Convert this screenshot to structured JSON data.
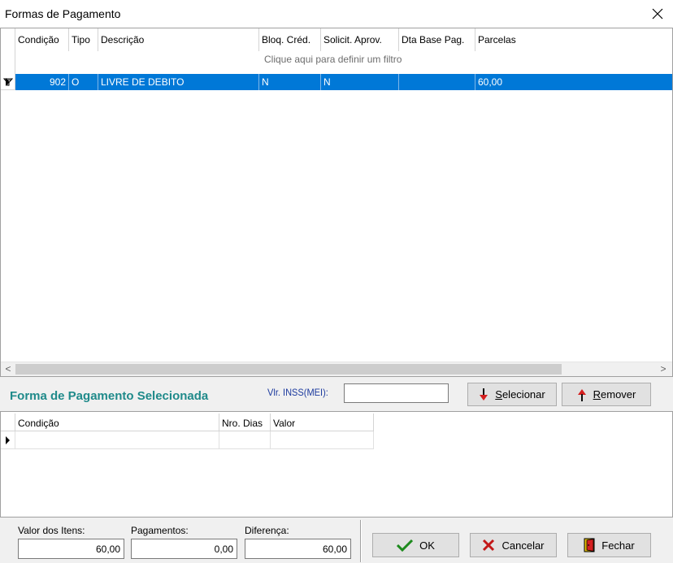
{
  "window": {
    "title": "Formas de Pagamento",
    "close_label": "✕"
  },
  "grid": {
    "columns": [
      "Condição",
      "Tipo",
      "Descrição",
      "Bloq. Créd.",
      "Solicit. Aprov.",
      "Dta Base Pag.",
      "Parcelas"
    ],
    "filter_hint": "Clique aqui para definir um filtro",
    "rows": [
      {
        "condicao": "902",
        "tipo": "O",
        "descricao": "LIVRE DE DEBITO",
        "bloq": "N",
        "solicit": "N",
        "dta_base": "",
        "parcelas": "60,00"
      }
    ],
    "scroll_left": "<",
    "scroll_right": ">"
  },
  "selected_section": {
    "heading": "Forma de Pagamento Selecionada",
    "inss_label": "Vlr. INSS(MEI):",
    "inss_value": "",
    "select_button": {
      "mnemonic": "S",
      "rest": "elecionar"
    },
    "remove_button": {
      "mnemonic": "R",
      "rest": "emover"
    }
  },
  "grid2": {
    "columns": [
      "Condição",
      "Nro. Dias",
      "Valor"
    ]
  },
  "totals": {
    "valor_itens_label": "Valor dos Itens:",
    "valor_itens": "60,00",
    "pagamentos_label": "Pagamentos:",
    "pagamentos": "0,00",
    "diferenca_label": "Diferença:",
    "diferenca": "60,00"
  },
  "actions": {
    "ok_label": "OK",
    "cancel_label": "Cancelar",
    "close_label": "Fechar"
  },
  "colors": {
    "selection": "#0078d7",
    "heading": "#1f8a8a",
    "inss_label": "#1c3a9e"
  }
}
